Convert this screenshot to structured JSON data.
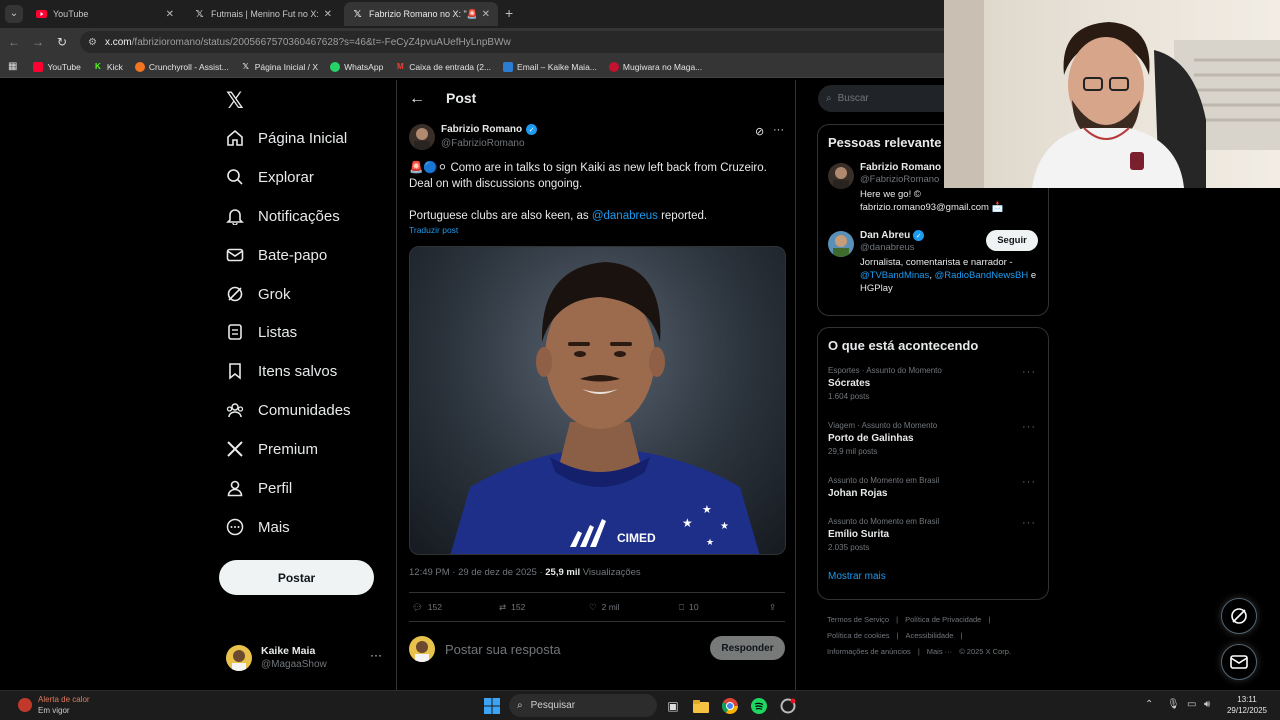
{
  "browser": {
    "tabs": [
      {
        "title": "YouTube"
      },
      {
        "title": "Futmais | Menino Fut no X: \"Os"
      },
      {
        "title": "Fabrizio Romano no X: \"🚨🔵⚪"
      }
    ],
    "url_host": "x.com",
    "url_path": "/fabrizioromano/status/2005667570360467628?s=46&t=-FeCyZ4pvuAUefHyLnpBWw",
    "bookmarks": [
      {
        "label": "YouTube"
      },
      {
        "label": "Kick"
      },
      {
        "label": "Crunchyroll - Assist..."
      },
      {
        "label": "Página Inicial / X"
      },
      {
        "label": "WhatsApp"
      },
      {
        "label": "Caixa de entrada (2..."
      },
      {
        "label": "Email – Kaike Maia..."
      },
      {
        "label": "Mugiwara no Maga..."
      }
    ]
  },
  "nav": {
    "items": [
      {
        "label": "Página Inicial",
        "icon": "home-icon"
      },
      {
        "label": "Explorar",
        "icon": "search-icon"
      },
      {
        "label": "Notificações",
        "icon": "bell-icon"
      },
      {
        "label": "Bate-papo",
        "icon": "mail-icon"
      },
      {
        "label": "Grok",
        "icon": "grok-icon"
      },
      {
        "label": "Listas",
        "icon": "list-icon"
      },
      {
        "label": "Itens salvos",
        "icon": "bookmark-icon"
      },
      {
        "label": "Comunidades",
        "icon": "communities-icon"
      },
      {
        "label": "Premium",
        "icon": "x-icon"
      },
      {
        "label": "Perfil",
        "icon": "profile-icon"
      },
      {
        "label": "Mais",
        "icon": "more-icon"
      }
    ],
    "post_button": "Postar",
    "account": {
      "name": "Kaike Maia",
      "handle": "@MagaaShow"
    }
  },
  "post": {
    "header": "Post",
    "author_name": "Fabrizio Romano",
    "author_handle": "@FabrizioRomano",
    "text_emoji": "🚨🔵⚪",
    "text_line1": " Como are in talks to sign Kaiki as new left back from Cruzeiro. Deal on with discussions ongoing.",
    "text_line2_before": "Portuguese clubs are also keen, as ",
    "text_mention": "@danabreus",
    "text_line2_after": " reported.",
    "translate": "Traduzir post",
    "image_sponsor": "CIMED",
    "timestamp": "12:49 PM · 29 de dez de 2025 · ",
    "views_count": "25,9 mil",
    "views_label": " Visualizações",
    "replies": "152",
    "reposts": "152",
    "likes": "2 mil",
    "bookmarks": "10",
    "reply_placeholder": "Postar sua resposta",
    "reply_button": "Responder"
  },
  "sidebar": {
    "search_placeholder": "Buscar",
    "relevant_title": "Pessoas relevante",
    "people": [
      {
        "name": "Fabrizio Romano",
        "handle": "@FabrizioRomano",
        "bio": "Here we go! © fabrizio.romano93@gmail.com 📩"
      },
      {
        "name": "Dan Abreu",
        "handle": "@danabreus",
        "bio_before": "Jornalista, comentarista e narrador - ",
        "bio_link1": "@TVBandMinas",
        "bio_sep": ", ",
        "bio_link2": "@RadioBandNewsBH",
        "bio_after": " e HGPlay",
        "follow": "Seguir"
      }
    ],
    "trends_title": "O que está acontecendo",
    "trends": [
      {
        "category": "Esportes · Assunto do Momento",
        "name": "Sócrates",
        "posts": "1.604 posts"
      },
      {
        "category": "Viagem · Assunto do Momento",
        "name": "Porto de Galinhas",
        "posts": "29,9 mil posts"
      },
      {
        "category": "Assunto do Momento em Brasil",
        "name": "Johan Rojas",
        "posts": ""
      },
      {
        "category": "Assunto do Momento em Brasil",
        "name": "Emílio Surita",
        "posts": "2.035 posts"
      }
    ],
    "show_more": "Mostrar mais",
    "footer": [
      "Termos de Serviço",
      "|",
      "Política de Privacidade",
      "|",
      "Política de cookies",
      "|",
      "Acessibilidade",
      "|",
      "Informações de anúncios",
      "|",
      "Mais ···",
      "© 2025 X Corp."
    ]
  },
  "taskbar": {
    "weather_title": "Alerta de calor",
    "weather_sub": "Em vigor",
    "search": "Pesquisar",
    "time": "13:11",
    "date": "29/12/2025"
  },
  "colors": {
    "accent": "#1d9bf0",
    "background": "#000000",
    "border": "#2f3336"
  }
}
